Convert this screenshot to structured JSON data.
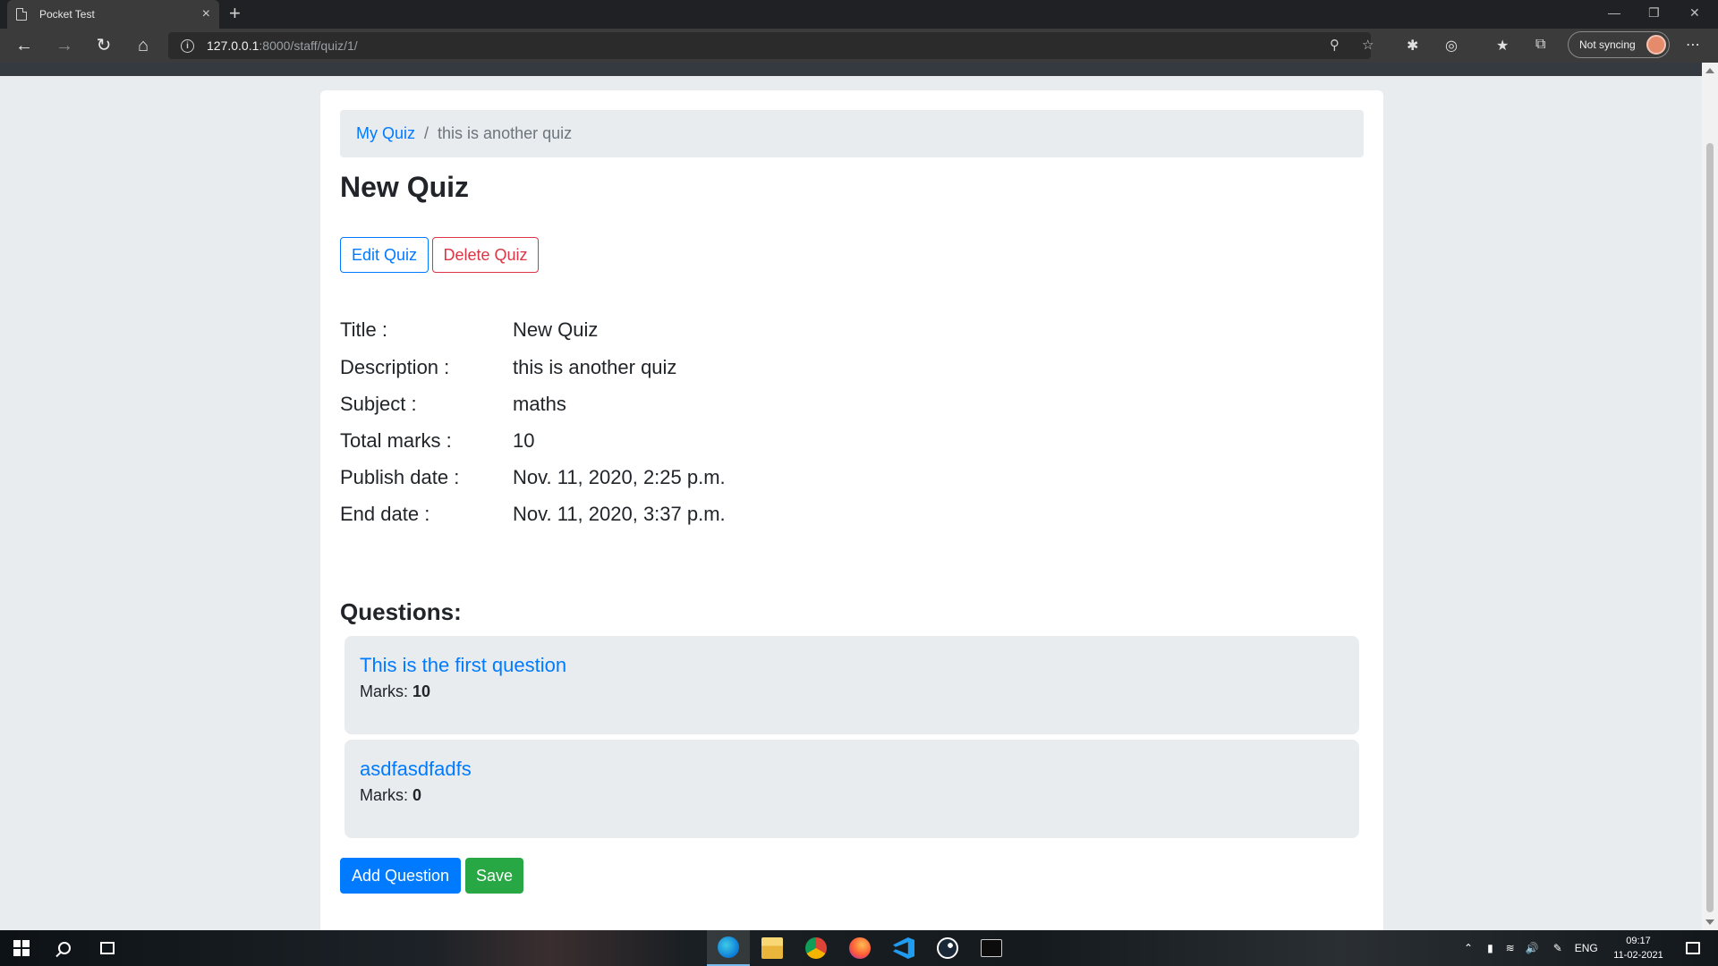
{
  "browser": {
    "tab_title": "Pocket Test",
    "tab_close": "×",
    "new_tab": "+",
    "url_host": "127.0.0.1",
    "url_rest": ":8000/staff/quiz/1/",
    "sync_label": "Not syncing",
    "icons": [
      "back-icon",
      "forward-icon",
      "refresh-icon",
      "home-icon",
      "info-icon",
      "zoom-icon",
      "favorite-add-icon",
      "extension-icon",
      "extension-circle-icon",
      "favorites-icon",
      "collections-icon",
      "more-icon"
    ]
  },
  "breadcrumb": {
    "link": "My Quiz",
    "separator": "/",
    "current": "this is another quiz"
  },
  "page_title": "New Quiz",
  "actions": {
    "edit": "Edit Quiz",
    "delete": "Delete Quiz"
  },
  "details": [
    {
      "label": "Title :",
      "value": "New Quiz"
    },
    {
      "label": "Description :",
      "value": "this is another quiz"
    },
    {
      "label": "Subject :",
      "value": "maths"
    },
    {
      "label": "Total marks :",
      "value": "10"
    },
    {
      "label": "Publish date :",
      "value": "Nov. 11, 2020, 2:25 p.m."
    },
    {
      "label": "End date :",
      "value": "Nov. 11, 2020, 3:37 p.m."
    }
  ],
  "questions_heading": "Questions:",
  "questions": [
    {
      "title": "This is the first question",
      "marks_label": "Marks:",
      "marks": "10"
    },
    {
      "title": "asdfasdfadfs",
      "marks_label": "Marks:",
      "marks": "0"
    }
  ],
  "footer_buttons": {
    "add": "Add Question",
    "save": "Save"
  },
  "taskbar": {
    "language": "ENG",
    "time": "09:17",
    "date": "11-02-2021"
  },
  "colors": {
    "primary": "#007bff",
    "danger": "#dc3545",
    "success": "#28a745",
    "page_bg": "#e9ecef",
    "navbar": "#343a40"
  }
}
